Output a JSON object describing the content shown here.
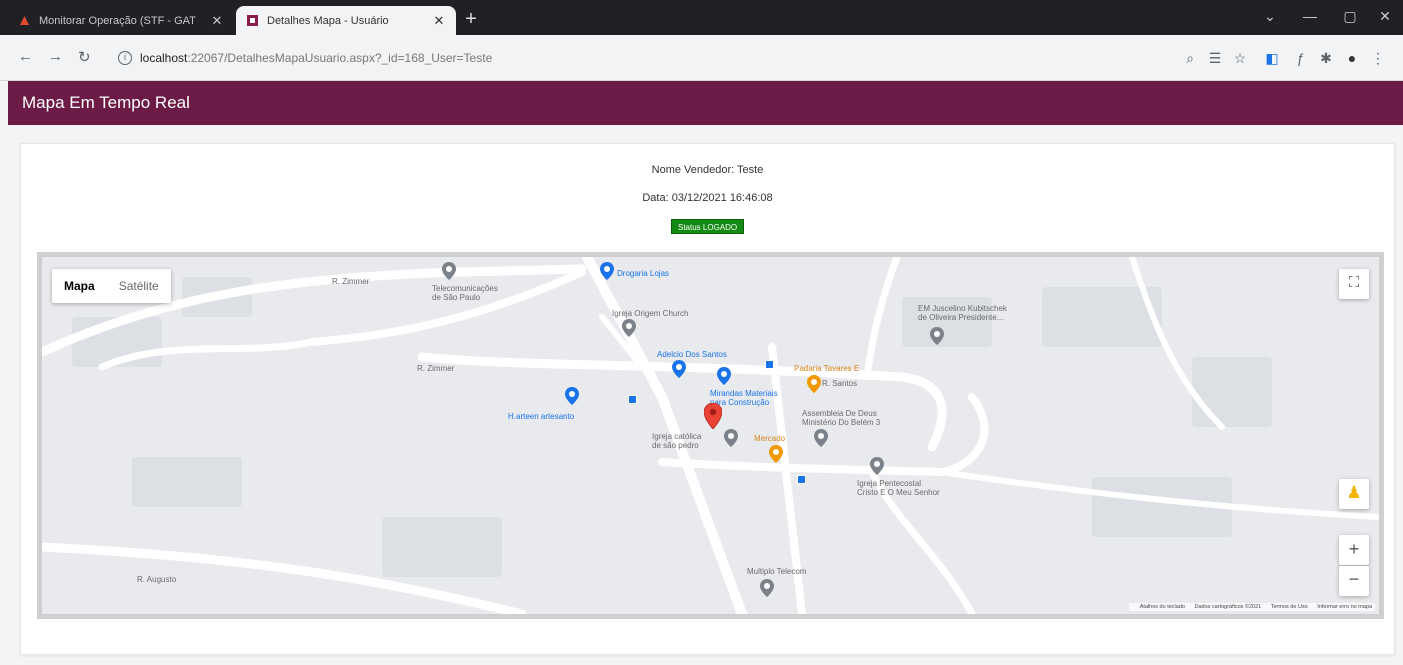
{
  "browser": {
    "tabs": [
      {
        "title": "Monitorar Operação (STF - GAT",
        "active": false
      },
      {
        "title": "Detalhes Mapa - Usuário",
        "active": true
      }
    ],
    "url_host": "localhost",
    "url_rest": ":22067/DetalhesMapaUsuario.aspx?_id=168_User=Teste"
  },
  "page": {
    "header_title": "Mapa Em Tempo Real",
    "vendor_line": "Nome Vendedor: Teste",
    "date_line": "Data: 03/12/2021 16:46:08",
    "status_badge": "Status LOGADO"
  },
  "map": {
    "type_buttons": {
      "map": "Mapa",
      "satellite": "Satélite"
    },
    "labels": {
      "r_zimmer": "R. Zimmer",
      "telecom": "Telecomunicações\nde São Paulo",
      "lojas_ingleses": "Drogaria Lojas",
      "igreja_church": "Igreja Origem Church",
      "emef": "EM Juscelino Kubitschek\nde Oliveira Presidente...",
      "adelcio": "Adelcio Dos Santos",
      "padaria": "Padaria Tavares E",
      "r_santos": "R. Santos",
      "r_zimmer2": "R. Zimmer",
      "materiais": "Mirandas Materiais\npara Construção",
      "assembleia": "Assembleia De Deus\nMinistério Do Belém 3",
      "h_artesanato": "H.arteen artesanto",
      "igreja_catolica": "Igreja católica\nde são pedro",
      "mercado": "Mercado",
      "igreja_pentecostal": "Igreja Pentecostal\nCristo E O Meu Senhor",
      "multiplo": "Multiplo Telecom",
      "r_augusto": "R. Augusto"
    },
    "attribution": [
      "Atalhos do teclado",
      "Dados cartográficos ©2021",
      "Termos de Uso",
      "Informar erro no mapa"
    ]
  },
  "colors": {
    "header": "#6b1b45",
    "status_bg": "#138a13",
    "marker": "#ea4335"
  }
}
